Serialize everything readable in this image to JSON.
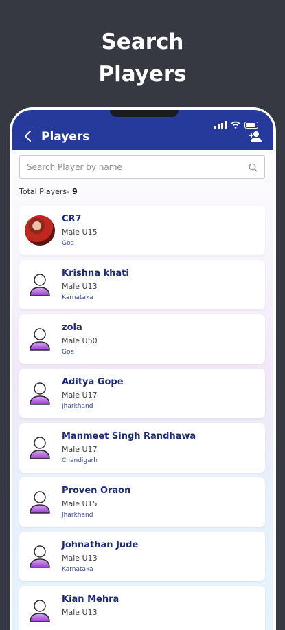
{
  "promo": {
    "title_line1": "Search",
    "title_line2": "Players"
  },
  "appbar": {
    "title": "Players",
    "back_icon": "chevron-left-icon",
    "action_icon": "add-user-icon",
    "color": "#253a9b"
  },
  "search": {
    "placeholder": "Search Player by name",
    "value": "",
    "icon": "search-icon"
  },
  "summary": {
    "label": "Total Players-",
    "count": "9"
  },
  "players": [
    {
      "name": "CR7",
      "info": "Male U15",
      "state": "Goa",
      "has_photo": true
    },
    {
      "name": "Krishna khati",
      "info": "Male U13",
      "state": "Karnataka",
      "has_photo": false
    },
    {
      "name": "zola",
      "info": "Male U50",
      "state": "Goa",
      "has_photo": false
    },
    {
      "name": "Aditya Gope",
      "info": "Male U17",
      "state": "Jharkhand",
      "has_photo": false
    },
    {
      "name": "Manmeet Singh Randhawa",
      "info": "Male U17",
      "state": "Chandigarh",
      "has_photo": false
    },
    {
      "name": "Proven Oraon",
      "info": "Male U15",
      "state": "Jharkhand",
      "has_photo": false
    },
    {
      "name": "Johnathan Jude",
      "info": "Male U13",
      "state": "Karnataka",
      "has_photo": false
    },
    {
      "name": "Kian Mehra",
      "info": "Male U13",
      "state": "",
      "has_photo": false
    }
  ]
}
